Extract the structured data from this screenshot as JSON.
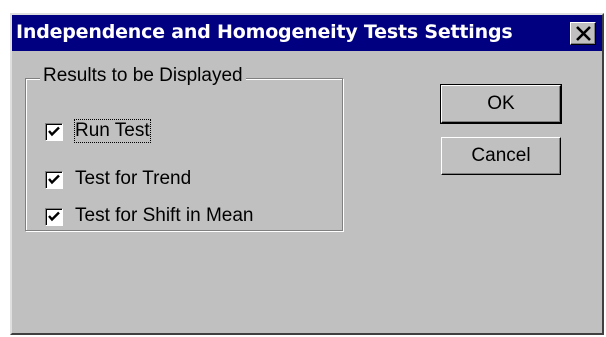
{
  "window": {
    "title": "Independence and Homogeneity Tests Settings",
    "close_icon": "close-x-icon"
  },
  "results_group": {
    "label": "Results to be Displayed",
    "options": [
      {
        "label": "Run Test",
        "checked": true,
        "focused": true
      },
      {
        "label": "Test for Trend",
        "checked": true,
        "focused": false
      },
      {
        "label": "Test for Shift in Mean",
        "checked": true,
        "focused": false
      }
    ]
  },
  "buttons": {
    "ok_label": "OK",
    "cancel_label": "Cancel"
  },
  "colors": {
    "titlebar": "#000080",
    "face": "#c0c0c0"
  }
}
